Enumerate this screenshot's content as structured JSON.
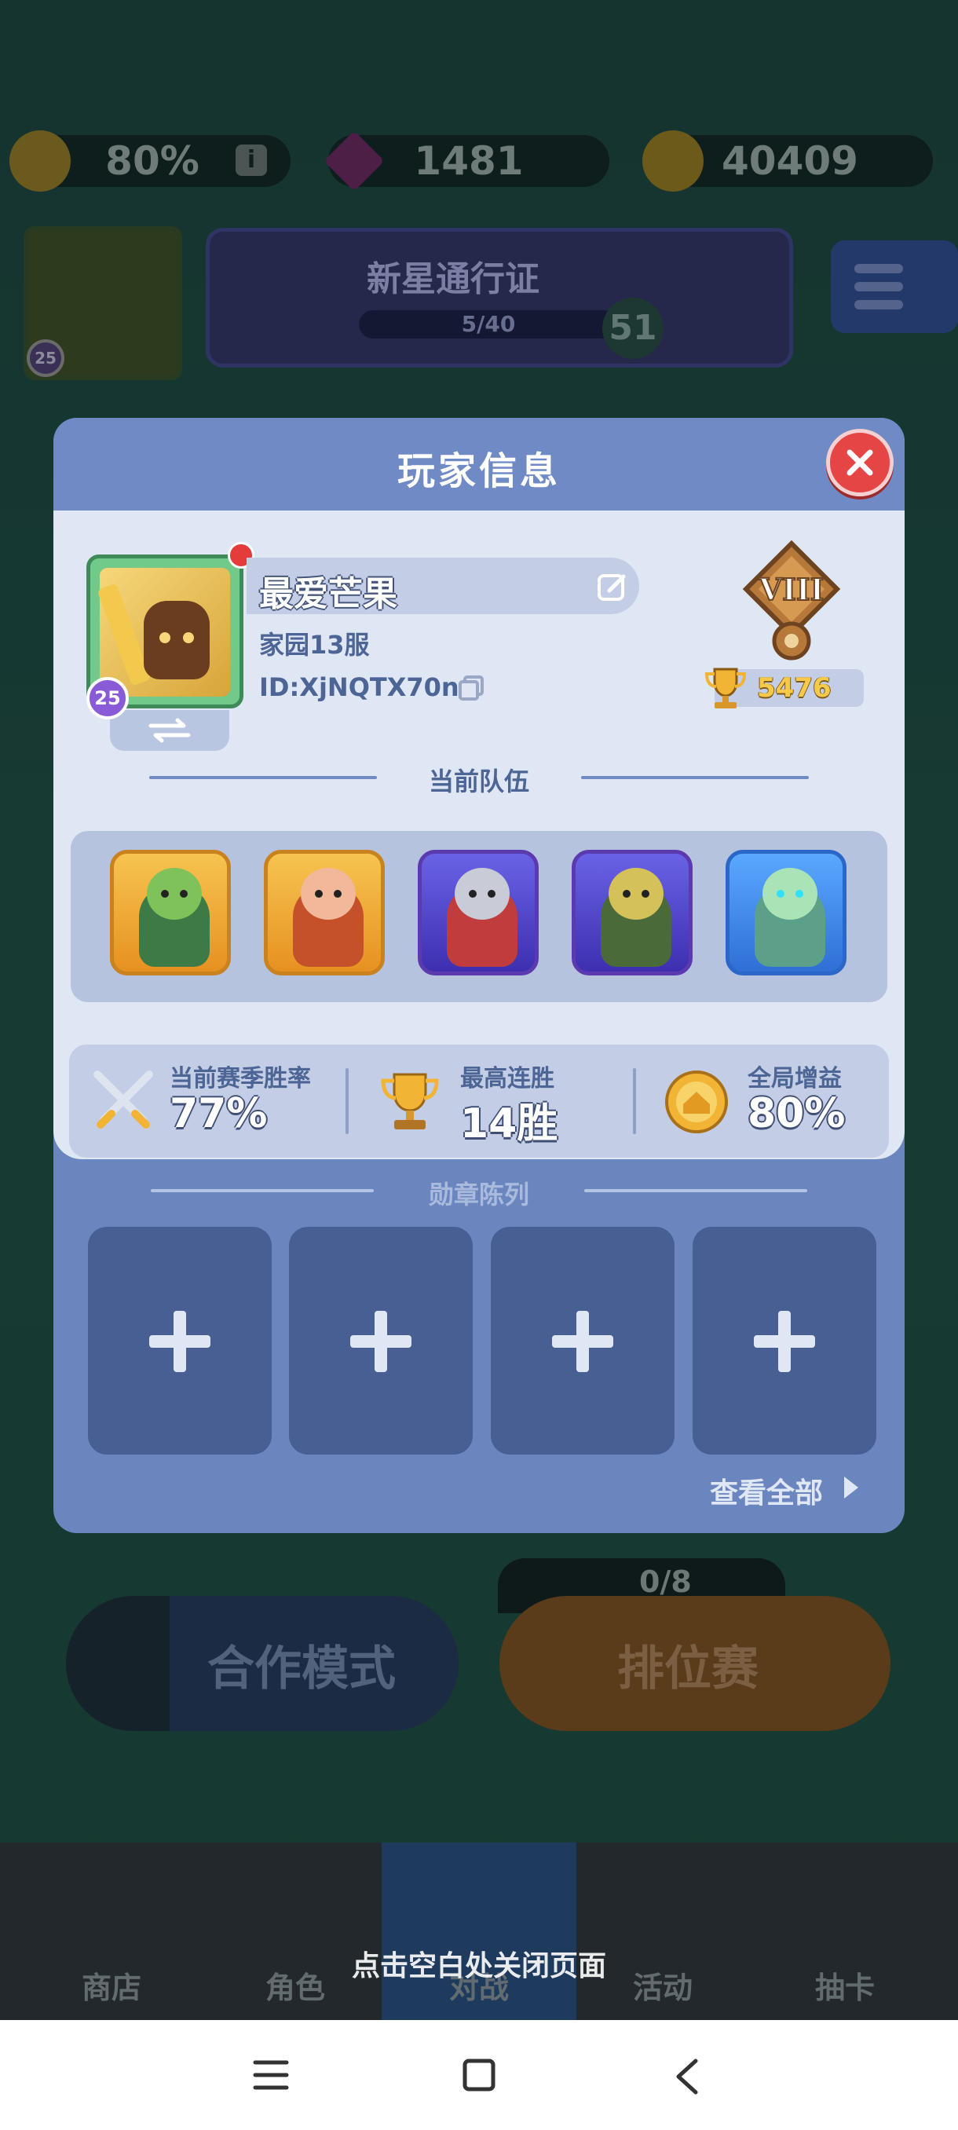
{
  "currency": {
    "bonus_percent": "80%",
    "info_label": "i",
    "gems": "1481",
    "coins": "40409"
  },
  "pass": {
    "title": "新星通行证",
    "progress": "5/40",
    "level": "51"
  },
  "avatar_level": "25",
  "modal": {
    "title": "玩家信息",
    "player_name": "最爱芒果",
    "server": "家园13服",
    "player_id": "ID:XjNQTX70nn",
    "avatar_level": "25",
    "rank_numeral": "VIII",
    "trophies": "5476",
    "team_label": "当前队伍",
    "stats": [
      {
        "label": "当前赛季胜率",
        "value": "77%",
        "icon": "crossed-swords-icon"
      },
      {
        "label": "最高连胜",
        "value": "14胜",
        "icon": "trophy-icon"
      },
      {
        "label": "全局增益",
        "value": "80%",
        "icon": "house-badge-icon"
      }
    ],
    "medals_label": "勋章陈列",
    "view_all": "查看全部"
  },
  "background": {
    "ranked_count": "0/8",
    "coop_mode": "合作模式",
    "ranked_mode": "排位赛",
    "nav": [
      "商店",
      "角色",
      "对战",
      "活动",
      "抽卡"
    ]
  },
  "close_hint": "点击空白处关闭页面",
  "colors": {
    "modal_header": "#6f8ac4",
    "panel": "#dfe6f4",
    "close_button": "#e54545",
    "text_blue": "#4d6594",
    "trophy_gold": "#f6c94a"
  }
}
